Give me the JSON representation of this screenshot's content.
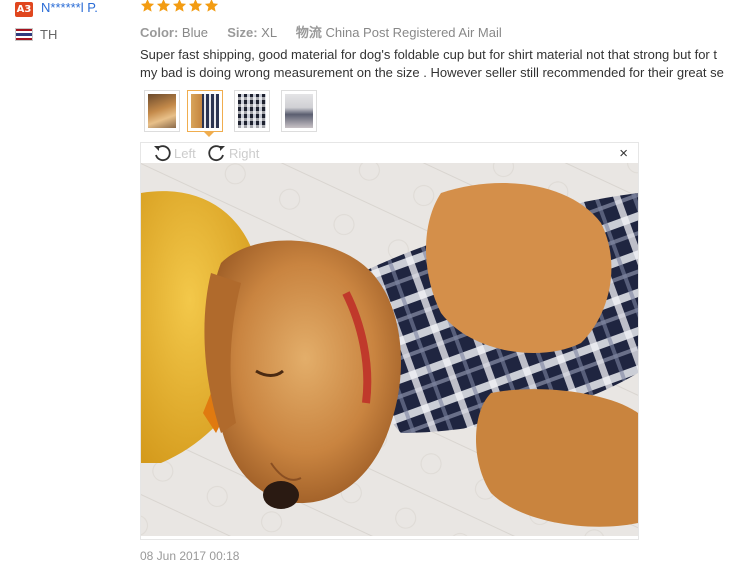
{
  "reviewer": {
    "level_badge": "A3",
    "name": "N******l P.",
    "country": "TH"
  },
  "rating": {
    "stars": 5,
    "max": 5,
    "color": "#f39c12"
  },
  "attributes": [
    {
      "key": "Color:",
      "value": "Blue"
    },
    {
      "key": "Size:",
      "value": "XL"
    },
    {
      "key": "物流",
      "value": "China Post Registered Air Mail"
    }
  ],
  "review_lines": [
    "Super fast shipping, good material for dog's foldable cup but for shirt material not that strong but for t",
    "my bad is doing wrong measurement on the size . However seller still recommended for their great se"
  ],
  "thumbnails": [
    {
      "label": "dog on rug"
    },
    {
      "label": "dog in plaid shirt sleeping"
    },
    {
      "label": "plaid shirt"
    },
    {
      "label": "dog items"
    }
  ],
  "viewer": {
    "rotate_left_label": "Left",
    "rotate_right_label": "Right",
    "close_label": "×"
  },
  "review_date": "08 Jun 2017 00:18",
  "icons": {
    "level_badge": "level-badge",
    "flag": "thailand-flag-icon",
    "star": "star-icon",
    "rotate_left": "rotate-left-icon",
    "rotate_right": "rotate-right-icon",
    "close": "close-icon"
  },
  "colors": {
    "name_link": "#2a6cd6",
    "badge": "#e0461e",
    "thumb_active": "#f0ad4e"
  }
}
